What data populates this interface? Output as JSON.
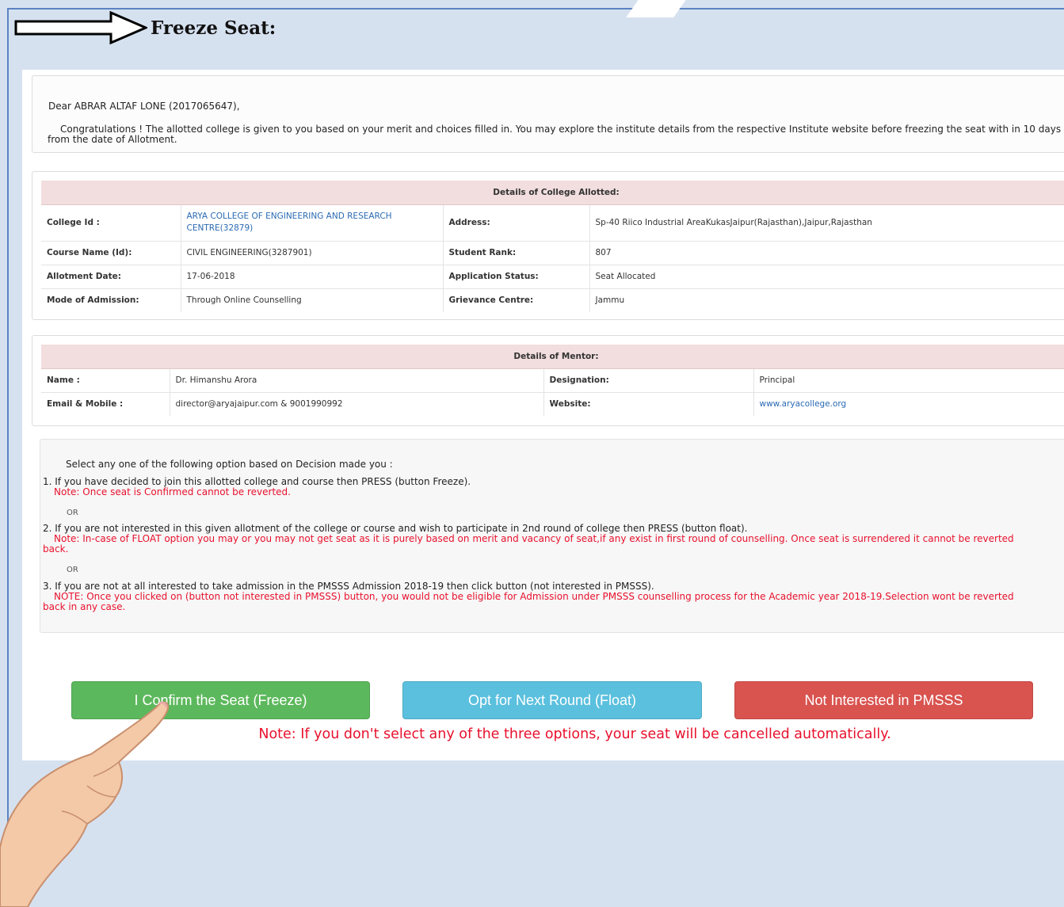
{
  "heading": {
    "title": "Freeze Seat:"
  },
  "greeting": {
    "salutation": "Dear ABRAR ALTAF LONE (2017065647),",
    "message": "Congratulations ! The allotted college is given to you based on your merit and choices filled in. You may explore the institute details from the respective Institute website before freezing the seat with in 10 days from the date of Allotment."
  },
  "college": {
    "title": "Details of College Allotted:",
    "labels": {
      "college_id": "College Id :",
      "address": "Address:",
      "course": "Course Name (Id):",
      "rank": "Student Rank:",
      "allotment_date": "Allotment Date:",
      "application_status": "Application Status:",
      "mode": "Mode of Admission:",
      "grievance": "Grievance Centre:"
    },
    "values": {
      "college_id_line1": "ARYA COLLEGE OF ENGINEERING AND RESEARCH",
      "college_id_line2": "CENTRE(32879)",
      "address": "Sp-40 Riico Industrial AreaKukasJaipur(Rajasthan),Jaipur,Rajasthan",
      "course": "CIVIL ENGINEERING(3287901)",
      "rank": "807",
      "allotment_date": "17-06-2018",
      "application_status": "Seat Allocated",
      "mode": "Through Online Counselling",
      "grievance": "Jammu"
    }
  },
  "mentor": {
    "title": "Details of Mentor:",
    "labels": {
      "name": "Name :",
      "designation": "Designation:",
      "email_mobile": "Email & Mobile :",
      "website": "Website:"
    },
    "values": {
      "name": "Dr. Himanshu Arora",
      "designation": "Principal",
      "email_mobile": "director@aryajaipur.com & 9001990992",
      "website": "www.aryacollege.org"
    }
  },
  "options": {
    "intro": "Select any one of the following option based on Decision made you :",
    "opt1": "1. If you have decided to join this allotted college and course then PRESS (button Freeze).",
    "opt1_note": "Note: Once seat is Confirmed cannot be reverted.",
    "or": "OR",
    "opt2": "2. If you are not interested in this given allotment of the college or course and wish to participate in 2nd round of college then    PRESS (button float).",
    "opt2_note_line1": "Note: In-case of FLOAT option you may or you may not get seat as it is purely based on merit and vacancy of seat,if any exist in    first round of counselling. Once seat is surrendered it cannot be reverted",
    "opt2_note_line2": "back.",
    "opt3": "3. If you are not at all interested to take admission in the PMSSS Admission 2018-19 then click button (not interested in PMSSS).",
    "opt3_note_line1": "NOTE: Once you clicked on (button not interested in PMSSS) button, you would not be eligible for Admission under PMSSS    counselling process for the Academic year 2018-19.Selection wont be reverted",
    "opt3_note_line2": "back in any case."
  },
  "buttons": {
    "freeze": "I Confirm the Seat (Freeze)",
    "float": "Opt for Next Round (Float)",
    "not_interested": "Not Interested in PMSSS"
  },
  "bottom_note": "Note: If you don't select any of the three options, your seat will be cancelled automatically.",
  "colors": {
    "freeze": "#5cb85c",
    "float": "#5bc0de",
    "not_interested": "#d9534f",
    "note_red": "#e8112d",
    "table_header": "#f2dede",
    "link": "#2a6ab2"
  },
  "icons": [
    "right-arrow-icon",
    "pointing-hand-icon"
  ]
}
